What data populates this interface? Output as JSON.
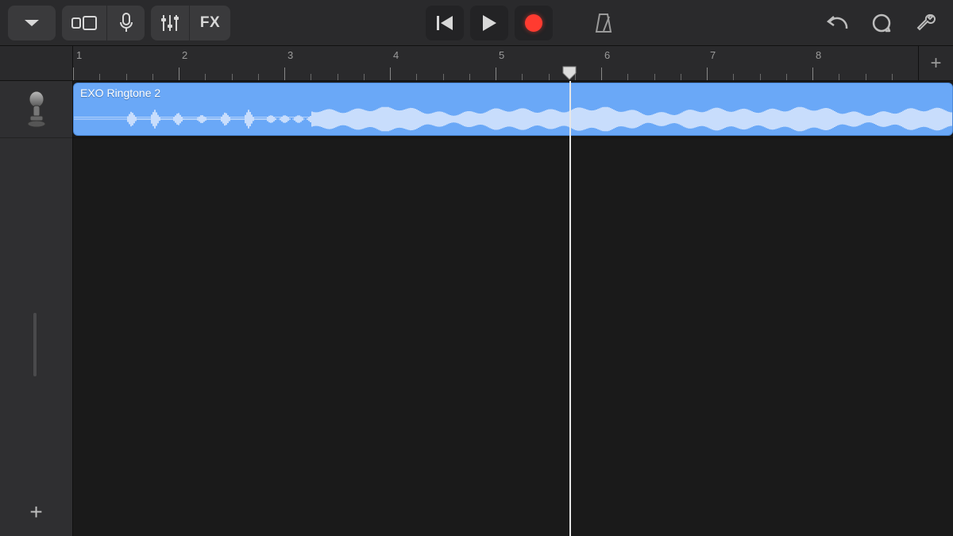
{
  "toolbar": {
    "fx_label": "FX"
  },
  "ruler": {
    "bars": [
      1,
      2,
      3,
      4,
      5,
      6,
      7,
      8
    ],
    "subdivisions": 4
  },
  "tracks": [
    {
      "icon": "microphone-icon",
      "clip": {
        "label": "EXO Ringtone 2"
      }
    }
  ],
  "playhead": {
    "bar_position": 5.7
  },
  "colors": {
    "clip_bg": "#6aa8f7",
    "clip_wave": "#c8ddfc",
    "record": "#ff3b30",
    "toolbar": "#2a2a2c"
  }
}
